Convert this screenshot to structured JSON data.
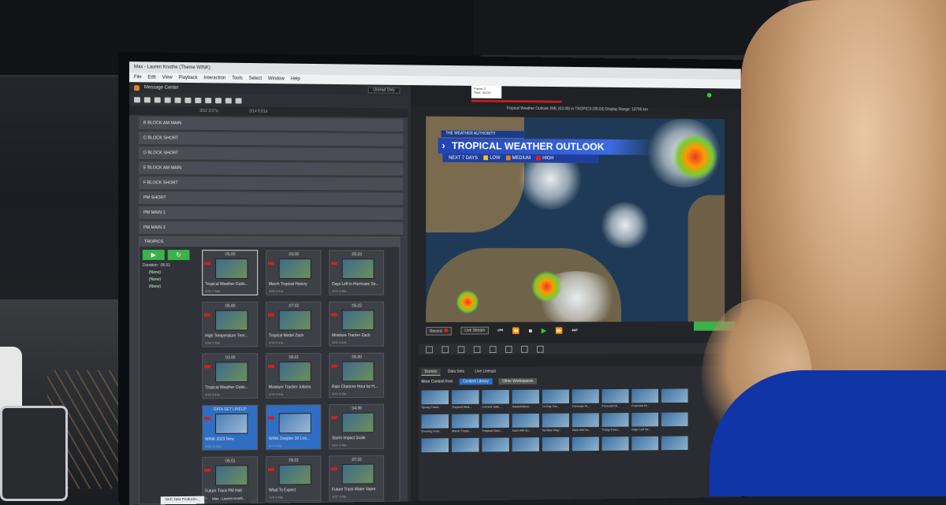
{
  "window": {
    "title": "Max - Lauren Knothe (Theme WINK)",
    "menu": [
      "File",
      "Edit",
      "View",
      "Playback",
      "Interaction",
      "Tools",
      "Select",
      "Window",
      "Help"
    ]
  },
  "message_center": {
    "title": "Message Center",
    "filter": "Unread Only",
    "times": [
      "3/12 3:07a",
      "3/14 5:01a"
    ],
    "blocks": [
      "B BLOCK AM MAIN",
      "C BLOCK SHORT",
      "D BLOCK SHORT",
      "E BLOCK AM MAIN",
      "F BLOCK SHORT",
      "PM SHORT",
      "PM MAIN 1",
      "PM MAIN 3"
    ]
  },
  "tropics": {
    "header": "TROPICS",
    "duration_label": "Duration:",
    "duration": ":05.51",
    "none_items": [
      "(None)",
      "(None)",
      "(None)"
    ],
    "cards": [
      {
        "num": ":05.00",
        "title": "Tropical Weather Outlo...",
        "meta": "3/20 7:56a",
        "sel": true,
        "blue": false
      },
      {
        "num": ":03.00",
        "title": "March Tropical History",
        "meta": "3/20 9:41a",
        "sel": false,
        "blue": false
      },
      {
        "num": ":05.03",
        "title": "Days Left in Hurricane Se...",
        "meta": "3/20 9:45a",
        "sel": false,
        "blue": false
      },
      {
        "num": ":05.00",
        "title": "High Temperature Tren...",
        "meta": "3/18 7:28a",
        "sel": false,
        "blue": false
      },
      {
        "num": ":07.02",
        "title": "Tropical Model Zach",
        "meta": "3/19 9:41a",
        "sel": false,
        "blue": false
      },
      {
        "num": ":05.02",
        "title": "Moisture Tracker Zach",
        "meta": "3/20 9:41a",
        "sel": false,
        "blue": false
      },
      {
        "num": ":03.00",
        "title": "Tropical Weather Outlo...",
        "meta": "3/19 6:43p",
        "sel": false,
        "blue": false
      },
      {
        "num": ":05.01",
        "title": "Moisture Tracker Juliana",
        "meta": "3/19 9:44a",
        "sel": false,
        "blue": false
      },
      {
        "num": ":05.00",
        "title": "Rain Chances Hour by H...",
        "meta": "3/20 9:45a",
        "sel": false,
        "blue": false
      },
      {
        "num": "DATA SET LINEUP",
        "title": "WINK 2023 New",
        "meta": "3/24 11:18a",
        "sel": false,
        "blue": true
      },
      {
        "num": "",
        "title": "WINK Doppler 3X Loo...",
        "meta": "3/4 2:01p",
        "sel": false,
        "blue": true
      },
      {
        "num": ":04.99",
        "title": "Storm Impact Scale",
        "meta": "3/20 9:45a",
        "sel": false,
        "blue": false
      },
      {
        "num": ":05.01",
        "title": "Future Track PM Halt",
        "meta": "3/27 9:05p",
        "sel": false,
        "blue": false
      },
      {
        "num": ":05.01",
        "title": "What To Expect",
        "meta": "11/6 9:48p",
        "sel": false,
        "blue": false
      },
      {
        "num": ":07.02",
        "title": "Future Track Water Vapor",
        "meta": "3/22 3:05p",
        "sel": false,
        "blue": false
      }
    ]
  },
  "viewer": {
    "frame_label": "Frame: 2",
    "time_label": "Time: :00.03",
    "caption": "Tropical Weather Outlook XML (03.00) in TROPICS (05.03)   Display Range: 10796 km",
    "brand": "THE WEATHER AUTHORITY",
    "title": "TROPICAL WEATHER OUTLOOK",
    "legend": {
      "days": "NEXT 7 DAYS",
      "low": "LOW",
      "medium": "MEDIUM",
      "high": "HIGH",
      "low_color": "#f2c230",
      "medium_color": "#f07c1a",
      "high_color": "#e02020"
    },
    "record": "Record",
    "live_stream": "Live Stream"
  },
  "library": {
    "tabs": [
      "Scenes",
      "Data Sets",
      "Live Lineups"
    ],
    "more_content": "More Content from",
    "content_library": "Content Library",
    "other_workspaces": "Other Workspaces",
    "scenes": [
      "Spring Traini...",
      "Tropical Wea...",
      "Current Sate...",
      "Satalofoteon...",
      "10 Day For...",
      "Forecast Te...",
      "Forecast Hi...",
      "Forecast Hi...",
      "",
      "Evening Fore...",
      "March Tropic...",
      "Tropical Ouro...",
      "Zach AM Ho...",
      "Surface Map...",
      "Zach AM Ho...",
      "Today Forec...",
      "Days Left Se...",
      "",
      "",
      "",
      "",
      "",
      "",
      "",
      "",
      "",
      ""
    ]
  },
  "taskbar": [
    "NHC New Productio...",
    "Max - Lauren Knoth..."
  ],
  "accent": "#3bb24a"
}
